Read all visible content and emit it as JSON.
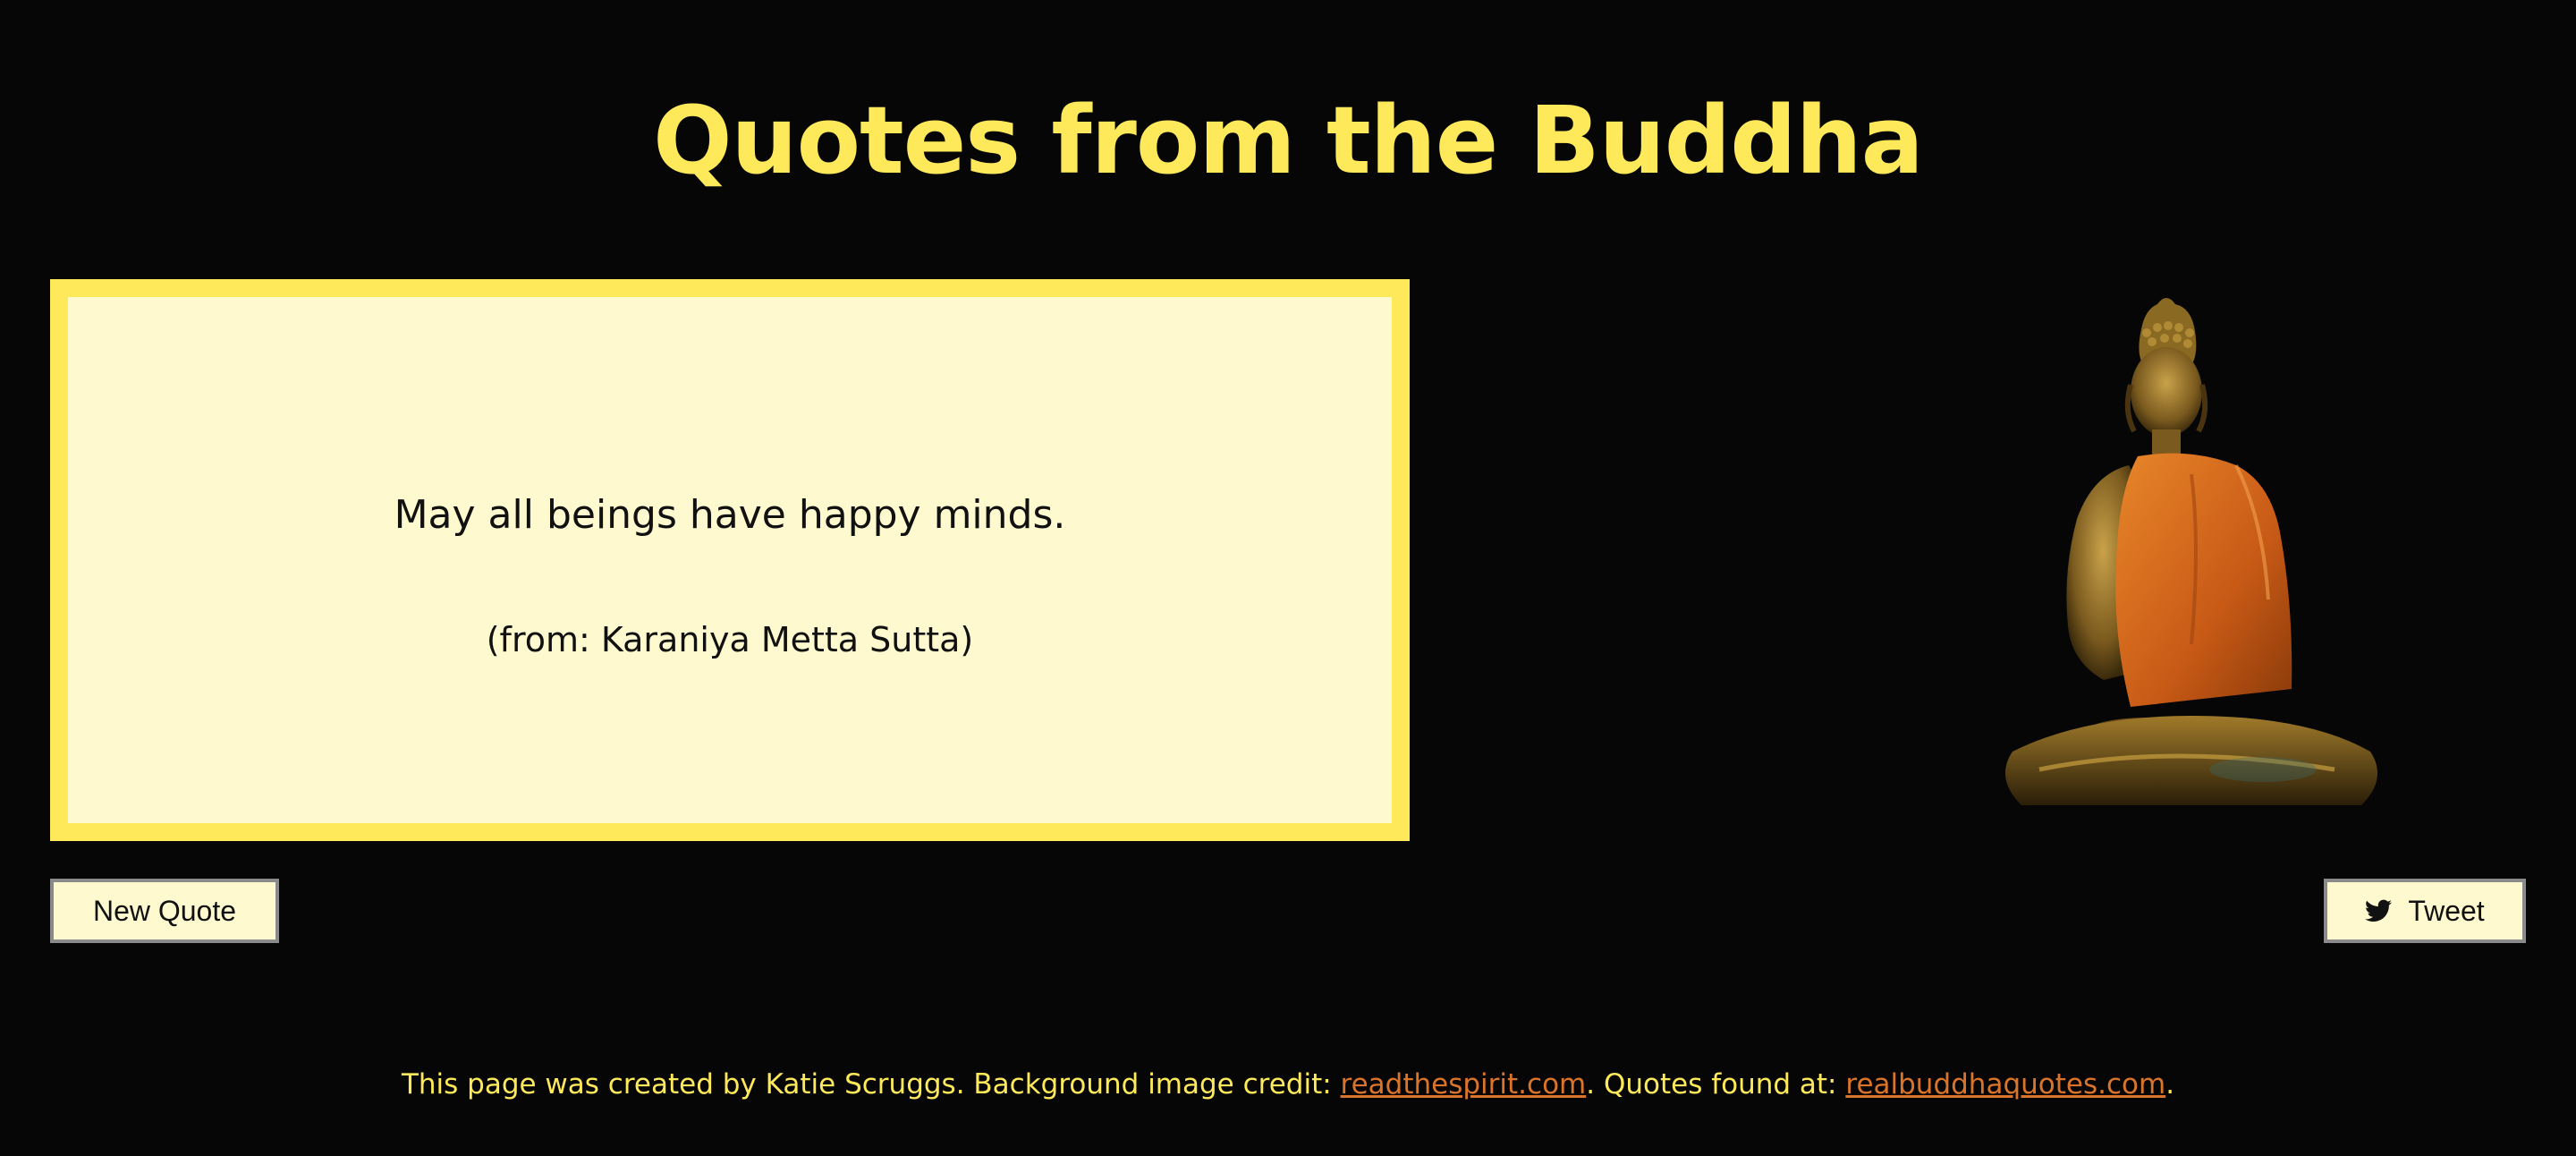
{
  "header": {
    "title": "Quotes from the Buddha"
  },
  "quote": {
    "text": "May all beings have happy minds.",
    "source": "(from: Karaniya Metta Sutta)"
  },
  "buttons": {
    "new_quote": "New Quote",
    "tweet": "Tweet",
    "tweet_icon": "twitter-bird-icon"
  },
  "footer": {
    "text_before": "This page was created by Katie Scruggs. Background image credit: ",
    "link1": "readthespirit.com",
    "text_middle": ". Quotes found at: ",
    "link2": "realbuddhaquotes.com",
    "text_after": "."
  },
  "colors": {
    "background": "#060606",
    "accent_yellow": "#fde95a",
    "quote_box_bg": "#fef9cf",
    "link_orange": "#d9742a"
  }
}
